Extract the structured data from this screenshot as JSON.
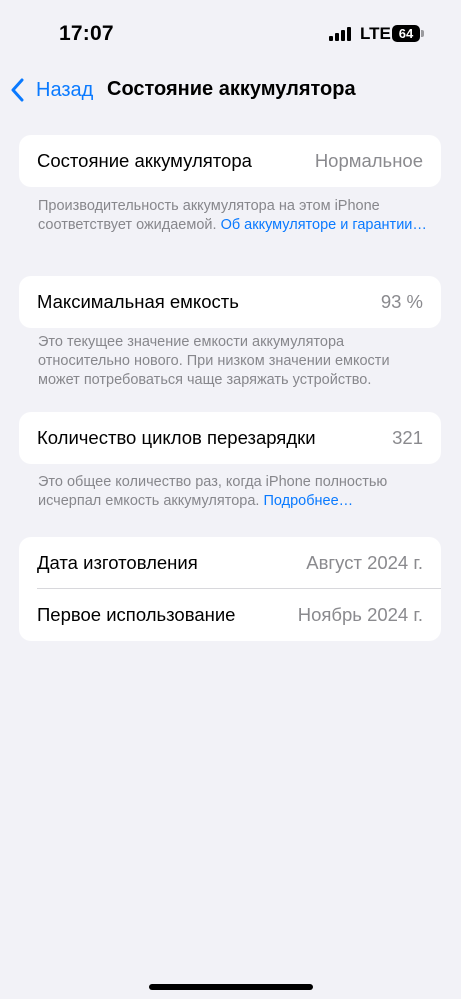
{
  "status_bar": {
    "time": "17:07",
    "network": "LTE",
    "battery": "64"
  },
  "nav": {
    "back_label": "Назад",
    "title": "Состояние аккумулятора"
  },
  "battery_health": {
    "label": "Состояние аккумулятора",
    "value": "Нормальное",
    "note": "Производительность аккумулятора на этом iPhone соответствует ожидаемой. ",
    "note_link": "Об аккумуляторе и гарантии…"
  },
  "max_capacity": {
    "label": "Максимальная емкость",
    "value": "93 %",
    "note": "Это текущее значение емкости аккумулятора относительно нового. При низком значении емкости может потребоваться чаще заряжать устройство."
  },
  "cycle_count": {
    "label": "Количество циклов перезарядки",
    "value": "321",
    "note": "Это общее количество раз, когда iPhone полностью исчерпал емкость аккумулятора. ",
    "note_link": "Подробнее…"
  },
  "dates": {
    "manufacture_label": "Дата изготовления",
    "manufacture_value": "Август 2024 г.",
    "first_use_label": "Первое использование",
    "first_use_value": "Ноябрь 2024 г."
  },
  "colors": {
    "accent": "#0a7aff",
    "background": "#f2f2f7",
    "secondary_text": "#8a8a8e"
  }
}
